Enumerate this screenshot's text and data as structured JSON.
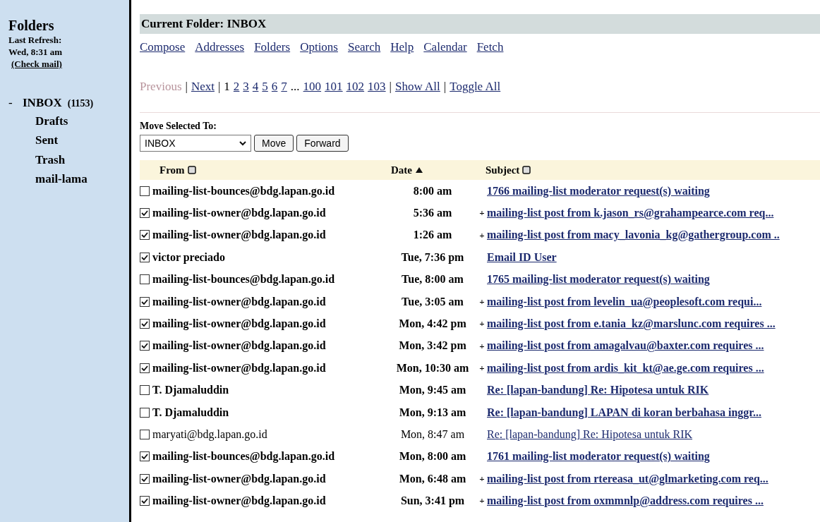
{
  "sidebar": {
    "title": "Folders",
    "refresh_label": "Last Refresh:",
    "refresh_time": "Wed, 8:31 am",
    "check_mail": "(Check mail)",
    "folders": [
      {
        "toggle": "-",
        "name": "INBOX",
        "count": "(1153)",
        "expanded": true,
        "children": [
          {
            "name": "Drafts"
          },
          {
            "name": "Sent"
          },
          {
            "name": "Trash"
          },
          {
            "name": "mail-lama"
          }
        ]
      }
    ]
  },
  "header": {
    "title": "Current Folder: INBOX"
  },
  "menu": [
    "Compose",
    "Addresses",
    "Folders",
    "Options",
    "Search",
    "Help",
    "Calendar",
    "Fetch"
  ],
  "pagination": [
    {
      "kind": "disabled",
      "label": "Previous"
    },
    {
      "kind": "separator",
      "label": "|"
    },
    {
      "kind": "link",
      "label": "Next"
    },
    {
      "kind": "separator",
      "label": "|"
    },
    {
      "kind": "current",
      "label": "1"
    },
    {
      "kind": "link",
      "label": "2"
    },
    {
      "kind": "link",
      "label": "3"
    },
    {
      "kind": "link",
      "label": "4"
    },
    {
      "kind": "link",
      "label": "5"
    },
    {
      "kind": "link",
      "label": "6"
    },
    {
      "kind": "link",
      "label": "7"
    },
    {
      "kind": "text",
      "label": "..."
    },
    {
      "kind": "link",
      "label": "100"
    },
    {
      "kind": "link",
      "label": "101"
    },
    {
      "kind": "link",
      "label": "102"
    },
    {
      "kind": "link",
      "label": "103"
    },
    {
      "kind": "separator",
      "label": "|"
    },
    {
      "kind": "link",
      "label": "Show All"
    },
    {
      "kind": "separator",
      "label": "|"
    },
    {
      "kind": "link",
      "label": "Toggle All"
    }
  ],
  "move": {
    "label": "Move Selected To:",
    "folder": "INBOX",
    "buttons": [
      "Move",
      "Forward"
    ]
  },
  "table": {
    "columns": [
      {
        "label": "From",
        "sorted": false
      },
      {
        "label": "Date",
        "sorted": true
      },
      {
        "label": "Subject",
        "sorted": false
      }
    ],
    "rows": [
      {
        "checked": false,
        "unread": true,
        "from": "mailing-list-bounces@bdg.lapan.go.id",
        "date": "8:00 am",
        "subject": "1766 mailing-list moderator request(s) waiting"
      },
      {
        "checked": true,
        "unread": true,
        "from": "mailing-list-owner@bdg.lapan.go.id",
        "date": "5:36 am",
        "flag": "+",
        "subject": "mailing-list post from k.jason_rs@grahampearce.com req..."
      },
      {
        "checked": true,
        "unread": true,
        "from": "mailing-list-owner@bdg.lapan.go.id",
        "date": "1:26 am",
        "flag": "+",
        "subject": "mailing-list post from macy_lavonia_kg@gathergroup.com .."
      },
      {
        "checked": true,
        "unread": true,
        "from": "victor preciado",
        "date": "Tue, 7:36 pm",
        "subject": "Email ID User"
      },
      {
        "checked": false,
        "unread": true,
        "from": "mailing-list-bounces@bdg.lapan.go.id",
        "date": "Tue, 8:00 am",
        "subject": "1765 mailing-list moderator request(s) waiting"
      },
      {
        "checked": true,
        "unread": true,
        "from": "mailing-list-owner@bdg.lapan.go.id",
        "date": "Tue, 3:05 am",
        "flag": "+",
        "subject": "mailing-list post from levelin_ua@peoplesoft.com requi..."
      },
      {
        "checked": true,
        "unread": true,
        "from": "mailing-list-owner@bdg.lapan.go.id",
        "date": "Mon, 4:42 pm",
        "flag": "+",
        "subject": "mailing-list post from e.tania_kz@marslunc.com requires ..."
      },
      {
        "checked": true,
        "unread": true,
        "from": "mailing-list-owner@bdg.lapan.go.id",
        "date": "Mon, 3:42 pm",
        "flag": "+",
        "subject": "mailing-list post from amagalvau@baxter.com requires ..."
      },
      {
        "checked": true,
        "unread": true,
        "from": "mailing-list-owner@bdg.lapan.go.id",
        "date": "Mon, 10:30 am",
        "flag": "+",
        "subject": "mailing-list post from ardis_kit_kt@ae.ge.com requires ..."
      },
      {
        "checked": false,
        "unread": true,
        "from": "T. Djamaluddin",
        "date": "Mon, 9:45 am",
        "subject": "Re: [lapan-bandung] Re: Hipotesa untuk RIK"
      },
      {
        "checked": false,
        "unread": true,
        "from": "T. Djamaluddin",
        "date": "Mon, 9:13 am",
        "subject": "Re: [lapan-bandung] LAPAN di koran berbahasa inggr..."
      },
      {
        "checked": false,
        "unread": false,
        "from": "maryati@bdg.lapan.go.id",
        "date": "Mon, 8:47 am",
        "subject": "Re: [lapan-bandung] Re: Hipotesa untuk RIK"
      },
      {
        "checked": true,
        "unread": true,
        "from": "mailing-list-bounces@bdg.lapan.go.id",
        "date": "Mon, 8:00 am",
        "subject": "1761 mailing-list moderator request(s) waiting"
      },
      {
        "checked": true,
        "unread": true,
        "from": "mailing-list-owner@bdg.lapan.go.id",
        "date": "Mon, 6:48 am",
        "flag": "+",
        "subject": "mailing-list post from rtereasa_ut@glmarketing.com req..."
      },
      {
        "checked": true,
        "unread": true,
        "from": "mailing-list-owner@bdg.lapan.go.id",
        "date": "Sun, 3:41 pm",
        "flag": "+",
        "subject": "mailing-list post from oxmmnlp@address.com requires ..."
      }
    ]
  }
}
